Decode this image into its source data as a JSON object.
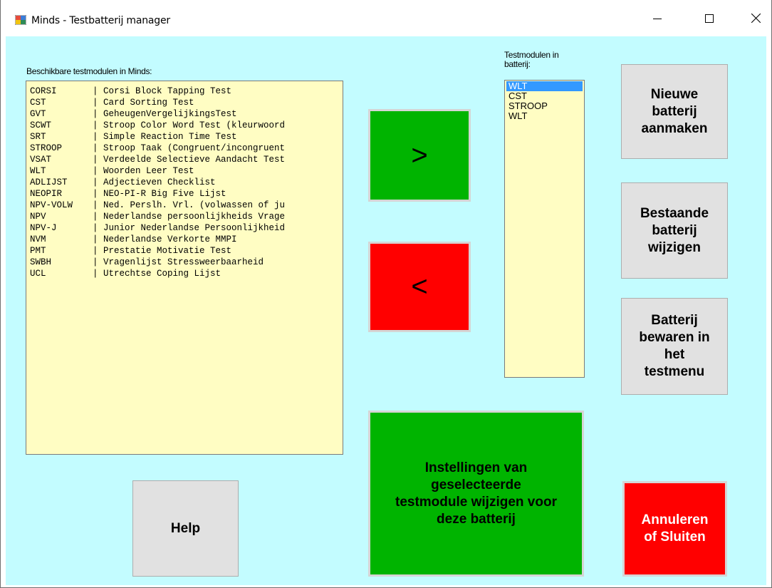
{
  "window": {
    "title": "Minds - Testbatterij manager",
    "icon": "app-window-icon",
    "controls": {
      "minimize": "minimize-icon",
      "maximize": "maximize-icon",
      "close": "close-icon"
    }
  },
  "available": {
    "label": "Beschikbare testmodulen in Minds:",
    "items": [
      {
        "code": "CORSI",
        "name": "| Corsi Block Tapping Test"
      },
      {
        "code": "CST",
        "name": "| Card Sorting Test"
      },
      {
        "code": "GVT",
        "name": "| GeheugenVergelijkingsTest"
      },
      {
        "code": "SCWT",
        "name": "| Stroop Color Word Test (kleurwoord"
      },
      {
        "code": "SRT",
        "name": "| Simple Reaction Time Test"
      },
      {
        "code": "STROOP",
        "name": "| Stroop Taak (Congruent/incongruent"
      },
      {
        "code": "VSAT",
        "name": "| Verdeelde Selectieve Aandacht Test"
      },
      {
        "code": "WLT",
        "name": "| Woorden Leer Test"
      },
      {
        "code": "ADLIJST",
        "name": "| Adjectieven Checklist"
      },
      {
        "code": "NEOPIR",
        "name": "| NEO-PI-R Big Five Lijst"
      },
      {
        "code": "NPV-VOLW",
        "name": "| Ned. Perslh. Vrl. (volwassen of ju"
      },
      {
        "code": "NPV",
        "name": "| Nederlandse persoonlijkheids Vrage"
      },
      {
        "code": "NPV-J",
        "name": "| Junior Nederlandse Persoonlijkheid"
      },
      {
        "code": "NVM",
        "name": "| Nederlandse Verkorte MMPI"
      },
      {
        "code": "PMT",
        "name": "| Prestatie Motivatie Test"
      },
      {
        "code": "SWBH",
        "name": "| Vragenlijst Stressweerbaarheid"
      },
      {
        "code": "UCL",
        "name": "| Utrechtse Coping Lijst"
      }
    ]
  },
  "battery": {
    "label_line1": "Testmodulen in",
    "label_line2": "batterij:",
    "items": [
      "WLT",
      "CST",
      "STROOP",
      "WLT"
    ],
    "selected_index": 0
  },
  "buttons": {
    "add": ">",
    "remove": "<",
    "settings_line1": "Instellingen van",
    "settings_line2": "geselecteerde",
    "settings_line3": "testmodule wijzigen voor",
    "settings_line4": "deze batterij",
    "new_line1": "Nieuwe",
    "new_line2": "batterij",
    "new_line3": "aanmaken",
    "edit_line1": "Bestaande",
    "edit_line2": "batterij",
    "edit_line3": "wijzigen",
    "save_line1": "Batterij",
    "save_line2": "bewaren in",
    "save_line3": "het",
    "save_line4": "testmenu",
    "help": "Help",
    "cancel_line1": "Annuleren",
    "cancel_line2": "of Sluiten"
  },
  "colors": {
    "background": "#c3fcff",
    "list_background": "#fffdc3",
    "green": "#00b400",
    "red": "#ff0000",
    "selection": "#3399ff"
  }
}
